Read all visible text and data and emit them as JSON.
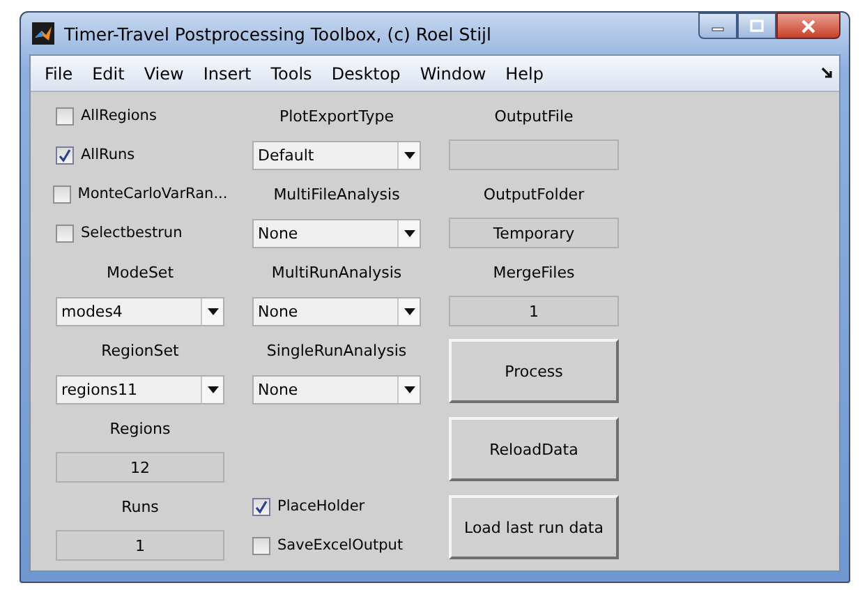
{
  "window": {
    "title": "Timer-Travel Postprocessing Toolbox, (c) Roel Stijl"
  },
  "menu": [
    "File",
    "Edit",
    "View",
    "Insert",
    "Tools",
    "Desktop",
    "Window",
    "Help"
  ],
  "columns": [
    [
      {
        "kind": "checkbox",
        "label": "AllRegions",
        "checked": false
      },
      {
        "kind": "checkbox",
        "label": "AllRuns",
        "checked": true
      },
      {
        "kind": "checkbox",
        "label": "MonteCarloVarRan...",
        "checked": false
      },
      {
        "kind": "checkbox",
        "label": "Selectbestrun",
        "checked": false
      },
      {
        "kind": "label",
        "text": "ModeSet"
      },
      {
        "kind": "popup",
        "value": "modes4"
      },
      {
        "kind": "label",
        "text": "RegionSet"
      },
      {
        "kind": "popup",
        "value": "regions11"
      },
      {
        "kind": "label",
        "text": "Regions"
      },
      {
        "kind": "edit",
        "value": "12"
      },
      {
        "kind": "label",
        "text": "Runs"
      },
      {
        "kind": "edit",
        "value": "1"
      }
    ],
    [
      {
        "kind": "label",
        "text": "PlotExportType"
      },
      {
        "kind": "popup",
        "value": "Default"
      },
      {
        "kind": "label",
        "text": "MultiFileAnalysis"
      },
      {
        "kind": "popup",
        "value": "None"
      },
      {
        "kind": "label",
        "text": "MultiRunAnalysis"
      },
      {
        "kind": "popup",
        "value": "None"
      },
      {
        "kind": "label",
        "text": "SingleRunAnalysis"
      },
      {
        "kind": "popup",
        "value": "None"
      },
      {
        "kind": "checkbox",
        "label": "PlaceHolder",
        "checked": true
      },
      {
        "kind": "checkbox",
        "label": "SaveExcelOutput",
        "checked": false
      }
    ],
    [
      {
        "kind": "label",
        "text": "OutputFile"
      },
      {
        "kind": "edit"
      },
      {
        "kind": "label",
        "text": "OutputFolder"
      },
      {
        "kind": "edit",
        "value": "Temporary"
      },
      {
        "kind": "label",
        "text": "MergeFiles"
      },
      {
        "kind": "edit",
        "value": "1"
      },
      {
        "kind": "button",
        "label": "Process"
      },
      {
        "kind": "button",
        "label": "ReloadData"
      },
      {
        "kind": "button",
        "label": "Load last run data"
      }
    ]
  ]
}
